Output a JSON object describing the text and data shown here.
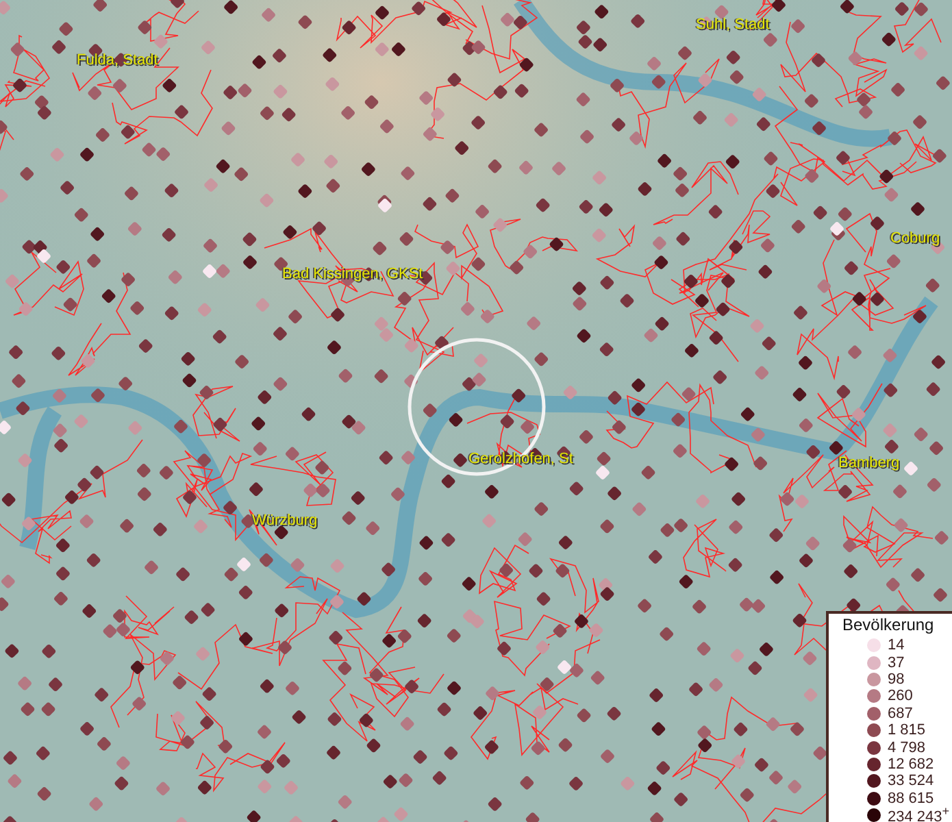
{
  "map": {
    "places": [
      {
        "name": "Suhl, Stadt"
      },
      {
        "name": "Fulda, Stadt"
      },
      {
        "name": "Coburg"
      },
      {
        "name": "Bad Kissingen, GKSt"
      },
      {
        "name": "Gerolzhofen, St"
      },
      {
        "name": "Bamberg"
      },
      {
        "name": "Würzburg"
      }
    ]
  },
  "legend": {
    "title": "Bevölkerung",
    "classes": [
      {
        "label": "14",
        "color": "#f6dfe8"
      },
      {
        "label": "37",
        "color": "#dfb6c2"
      },
      {
        "label": "98",
        "color": "#c9979f"
      },
      {
        "label": "260",
        "color": "#b57a84"
      },
      {
        "label": "687",
        "color": "#a2606a"
      },
      {
        "label": "1 815",
        "color": "#8e4a52"
      },
      {
        "label": "4 798",
        "color": "#7a3640"
      },
      {
        "label": "12 682",
        "color": "#66252e"
      },
      {
        "label": "33 524",
        "color": "#52171f"
      },
      {
        "label": "88 615",
        "color": "#3e0c13"
      },
      {
        "label": "234 243$^{+}$",
        "color": "#2a0408"
      }
    ]
  }
}
